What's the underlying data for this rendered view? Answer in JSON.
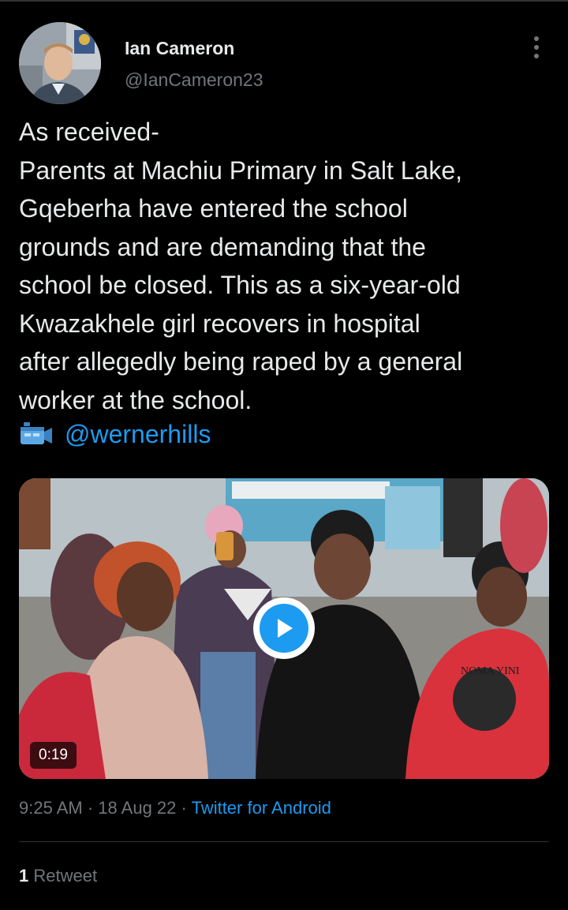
{
  "author": {
    "name": "Ian Cameron",
    "handle": "@IanCameron23"
  },
  "tweet": {
    "text": "As received-\nParents at Machiu Primary in Salt Lake,\nGqeberha have entered the school\ngrounds and are demanding that the\nschool be closed. This as a six-year-old\nKwazakhele girl recovers in hospital\nafter allegedly being raped by a general\nworker at the school.",
    "credit_icon": "video-camera-icon",
    "credit_mention": "@wernerhills"
  },
  "media": {
    "duration": "0:19",
    "play_icon": "play-icon",
    "shirt_text": "NOMA YINI"
  },
  "meta": {
    "time": "9:25 AM",
    "separator": "·",
    "date": "18 Aug 22",
    "source": "Twitter for Android"
  },
  "stats": {
    "retweet_count": "1",
    "retweet_label": "Retweet"
  },
  "colors": {
    "background": "#000000",
    "text": "#e7e9ea",
    "secondary": "#71767b",
    "accent": "#1d9bf0",
    "divider": "#2f3336"
  }
}
